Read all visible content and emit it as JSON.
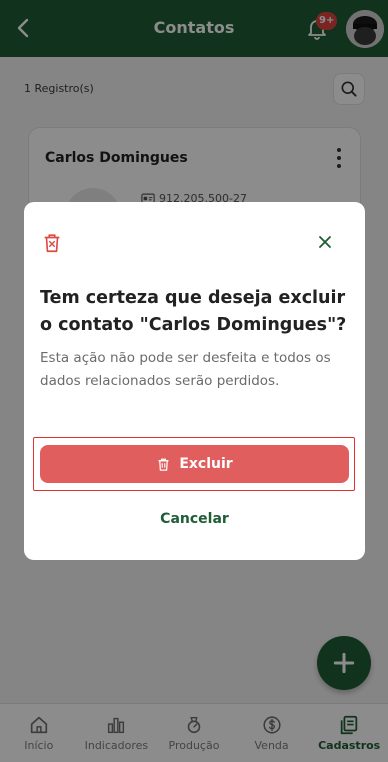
{
  "header": {
    "title": "Contatos",
    "badge": "9+"
  },
  "list": {
    "records_label": "1 Registro(s)"
  },
  "card": {
    "name": "Carlos Domingues",
    "document": "912.205.500-27"
  },
  "bottom_nav": {
    "items": [
      {
        "label": "Início",
        "icon": "home-icon"
      },
      {
        "label": "Indicadores",
        "icon": "chart-icon"
      },
      {
        "label": "Produção",
        "icon": "scale-icon"
      },
      {
        "label": "Venda",
        "icon": "dollar-icon"
      },
      {
        "label": "Cadastros",
        "icon": "cards-icon"
      }
    ],
    "active": "Cadastros"
  },
  "dialog": {
    "title": "Tem certeza que deseja excluir o contato \"Carlos Domingues\"?",
    "message": "Esta ação não pode ser desfeita e todos os dados relacionados serão perdidos.",
    "delete_label": "Excluir",
    "cancel_label": "Cancelar"
  },
  "colors": {
    "primary": "#1f5d35",
    "danger": "#e05f5e",
    "badge": "#e0443f"
  }
}
